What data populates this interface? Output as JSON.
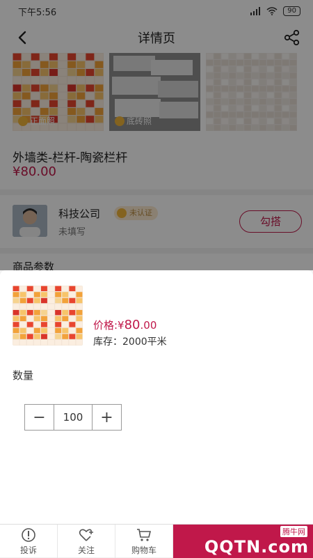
{
  "status_bar": {
    "time": "下午5:56",
    "battery": "90"
  },
  "nav": {
    "title": "详情页"
  },
  "product": {
    "thumbnails": [
      {
        "label": "正面照"
      },
      {
        "label": "底砖照"
      },
      {
        "label": ""
      }
    ],
    "name": "外墙类-栏杆-陶瓷栏杆",
    "price": "¥80.00"
  },
  "seller": {
    "name": "科技公司",
    "badge": "未认证",
    "subtitle": "未填写",
    "contact_label": "勾搭"
  },
  "section": {
    "params_title": "商品参数"
  },
  "sheet": {
    "price_prefix": "价格:¥",
    "price_main": "80",
    "price_decimal": ".00",
    "stock": "库存：2000平米",
    "quantity_label": "数量",
    "quantity_value": "100",
    "minus": "−",
    "plus": "+"
  },
  "tabs": [
    {
      "label": "投诉",
      "icon": "warning-circle-icon"
    },
    {
      "label": "关注",
      "icon": "heart-plus-icon"
    },
    {
      "label": "购物车",
      "icon": "cart-icon"
    }
  ],
  "watermark": {
    "tag": "腾牛网",
    "text": "QQTN.com"
  }
}
